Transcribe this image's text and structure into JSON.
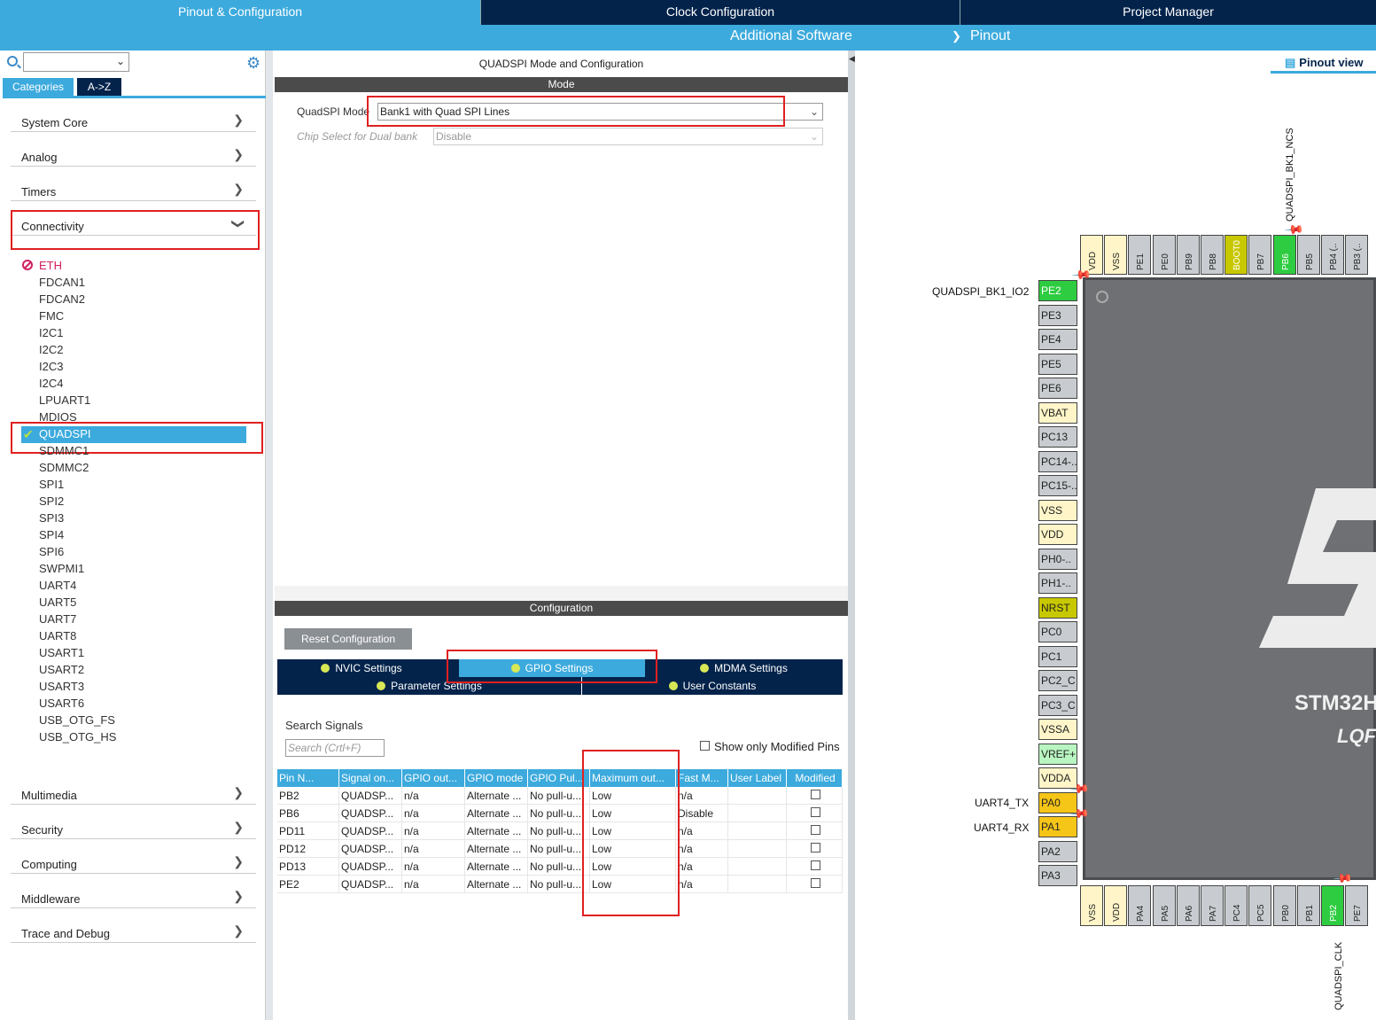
{
  "top_tabs": [
    "Pinout & Configuration",
    "Clock Configuration",
    "Project Manager"
  ],
  "sub_tabs": {
    "additional_software": "Additional Software",
    "pinout": "Pinout"
  },
  "left": {
    "category_tabs": [
      "Categories",
      "A->Z"
    ],
    "categories_top": [
      {
        "label": "System Core",
        "arrow": ">"
      },
      {
        "label": "Analog",
        "arrow": ">"
      },
      {
        "label": "Timers",
        "arrow": ">"
      },
      {
        "label": "Connectivity",
        "arrow": "v"
      }
    ],
    "connectivity_items": [
      "ETH",
      "FDCAN1",
      "FDCAN2",
      "FMC",
      "I2C1",
      "I2C2",
      "I2C3",
      "I2C4",
      "LPUART1",
      "MDIOS",
      "QUADSPI",
      "SDMMC1",
      "SDMMC2",
      "SPI1",
      "SPI2",
      "SPI3",
      "SPI4",
      "SPI6",
      "SWPMI1",
      "UART4",
      "UART5",
      "UART7",
      "UART8",
      "USART1",
      "USART2",
      "USART3",
      "USART6",
      "USB_OTG_FS",
      "USB_OTG_HS"
    ],
    "categories_bottom": [
      {
        "label": "Multimedia",
        "arrow": ">"
      },
      {
        "label": "Security",
        "arrow": ">"
      },
      {
        "label": "Computing",
        "arrow": ">"
      },
      {
        "label": "Middleware",
        "arrow": ">"
      },
      {
        "label": "Trace and Debug",
        "arrow": ">"
      }
    ]
  },
  "middle": {
    "title": "QUADSPI Mode and Configuration",
    "mode_header": "Mode",
    "quadspi_mode_label": "QuadSPI Mode",
    "quadspi_mode_value": "Bank1 with Quad SPI Lines",
    "chip_select_label": "Chip Select for Dual bank",
    "chip_select_value": "Disable",
    "config_header": "Configuration",
    "reset_button": "Reset Configuration",
    "tabs_row1": [
      "NVIC Settings",
      "GPIO Settings",
      "MDMA Settings"
    ],
    "tabs_row2": [
      "Parameter Settings",
      "User Constants"
    ],
    "search_signals_label": "Search Signals",
    "search_placeholder": "Search (Crtl+F)",
    "show_modified_label": "Show only Modified Pins",
    "table_headers": [
      "Pin N...",
      "Signal on...",
      "GPIO out...",
      "GPIO mode",
      "GPIO Pul...",
      "Maximum out...",
      "Fast M...",
      "User Label",
      "Modified"
    ],
    "table_rows": [
      [
        "PB2",
        "QUADSP...",
        "n/a",
        "Alternate ...",
        "No pull-u...",
        "Low",
        "n/a",
        ""
      ],
      [
        "PB6",
        "QUADSP...",
        "n/a",
        "Alternate ...",
        "No pull-u...",
        "Low",
        "Disable",
        ""
      ],
      [
        "PD11",
        "QUADSP...",
        "n/a",
        "Alternate ...",
        "No pull-u...",
        "Low",
        "n/a",
        ""
      ],
      [
        "PD12",
        "QUADSP...",
        "n/a",
        "Alternate ...",
        "No pull-u...",
        "Low",
        "n/a",
        ""
      ],
      [
        "PD13",
        "QUADSP...",
        "n/a",
        "Alternate ...",
        "No pull-u...",
        "Low",
        "n/a",
        ""
      ],
      [
        "PE2",
        "QUADSP...",
        "n/a",
        "Alternate ...",
        "No pull-u...",
        "Low",
        "n/a",
        ""
      ]
    ]
  },
  "right": {
    "pinout_view_label": "Pinout view",
    "top_pins": [
      "VDD",
      "VSS",
      "PE1",
      "PE0",
      "PB9",
      "PB8",
      "BOOT0",
      "PB7",
      "PB6",
      "PB5",
      "PB4 (..",
      "PB3 (.."
    ],
    "left_pins": [
      "PE2",
      "PE3",
      "PE4",
      "PE5",
      "PE6",
      "VBAT",
      "PC13",
      "PC14-..",
      "PC15-..",
      "VSS",
      "VDD",
      "PH0-..",
      "PH1-..",
      "NRST",
      "PC0",
      "PC1",
      "PC2_C",
      "PC3_C",
      "VSSA",
      "VREF+",
      "VDDA",
      "PA0",
      "PA1",
      "PA2",
      "PA3"
    ],
    "bottom_pins": [
      "VSS",
      "VDD",
      "PA4",
      "PA5",
      "PA6",
      "PA7",
      "PC4",
      "PC5",
      "PB0",
      "PB1",
      "PB2",
      "PE7"
    ],
    "signal_labels": {
      "top_ncs": "QUADSPI_BK1_NCS",
      "pe2": "QUADSPI_BK1_IO2",
      "pa0": "UART4_TX",
      "pa1": "UART4_RX",
      "bottom_clk": "QUADSPI_CLK"
    },
    "chip_text_1": "STM32H",
    "chip_text_2": "LQF"
  },
  "colors": {
    "navy": "#03234b",
    "accent": "#3caadd",
    "pin_green": "#2ecc40",
    "pin_yellow": "#fff5c8",
    "pin_orange": "#f5c518",
    "pin_olive": "#c8c800",
    "pin_gray": "#c8ccd0",
    "highlight_red": "#e02020"
  }
}
